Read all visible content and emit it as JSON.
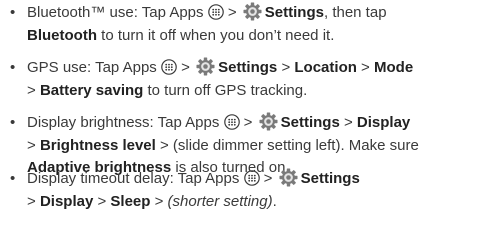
{
  "bullet": "•",
  "items": [
    {
      "lines": [
        [
          "Bluetooth™ use: Tap Apps ",
          " > ",
          "Settings",
          ", then tap"
        ],
        [
          "Bluetooth",
          " to turn it off when you don’t need it."
        ]
      ]
    },
    {
      "lines": [
        [
          "GPS use: Tap Apps ",
          " > ",
          "Settings",
          " > ",
          "Location",
          " > ",
          "Mode"
        ],
        [
          "> ",
          "Battery saving",
          " to turn off GPS tracking."
        ]
      ]
    },
    {
      "lines": [
        [
          "Display brightness: Tap Apps ",
          " > ",
          "Settings",
          " > ",
          "Display"
        ],
        [
          "> ",
          "Brightness level",
          " >  (slide dimmer setting left). Make sure"
        ],
        [
          "Adaptive brightness",
          " is also turned on."
        ]
      ]
    },
    {
      "lines": [
        [
          "Display timeout delay: Tap Apps ",
          " > ",
          "Settings"
        ],
        [
          "> ",
          "Display",
          " > ",
          "Sleep",
          " > ",
          "(shorter setting)",
          "."
        ]
      ]
    }
  ],
  "icons": {
    "apps": "apps-icon",
    "settings": "gear-icon"
  },
  "colors": {
    "text": "#3a3a3a",
    "bold": "#222222",
    "gear": "#7a7a7a"
  }
}
